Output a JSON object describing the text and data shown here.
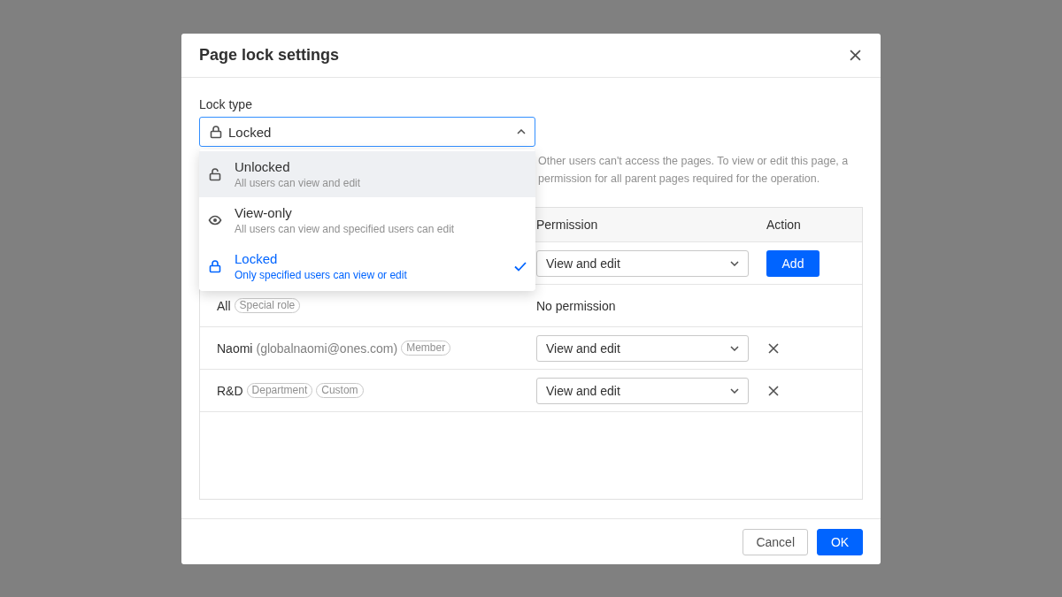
{
  "dialog": {
    "title": "Page lock settings"
  },
  "lock_type": {
    "label": "Lock type",
    "value": "Locked",
    "expanded": true,
    "options": [
      {
        "kind": "unlocked",
        "label": "Unlocked",
        "description": "All users can view and edit",
        "selected": false,
        "highlighted": true
      },
      {
        "kind": "view",
        "label": "View-only",
        "description": "All users can view and  specified users can edit",
        "selected": false,
        "highlighted": false
      },
      {
        "kind": "locked",
        "label": "Locked",
        "description": "Only specified users can view or edit",
        "selected": true,
        "highlighted": false
      }
    ]
  },
  "description_lines": [
    "Other users can't access the pages. To view or edit this page, a",
    "permission for all parent pages required for the operation."
  ],
  "table": {
    "columns": [
      "Permission",
      "Action"
    ],
    "rows": [
      {
        "kind": "add",
        "permission": "View and edit",
        "action": "Add"
      },
      {
        "kind": "fixed",
        "name": "All",
        "tags": [
          "Special role"
        ],
        "permission": "No permission"
      },
      {
        "kind": "member",
        "name": "Naomi",
        "email": "(globalnaomi@ones.com)",
        "tags": [
          "Member"
        ],
        "permission": "View and edit"
      },
      {
        "kind": "member",
        "name": "R&D",
        "tags": [
          "Department",
          "Custom"
        ],
        "permission": "View and edit"
      }
    ]
  },
  "buttons": [
    {
      "kind": "secondary",
      "label": "Cancel"
    },
    {
      "kind": "primary",
      "label": "OK"
    }
  ]
}
